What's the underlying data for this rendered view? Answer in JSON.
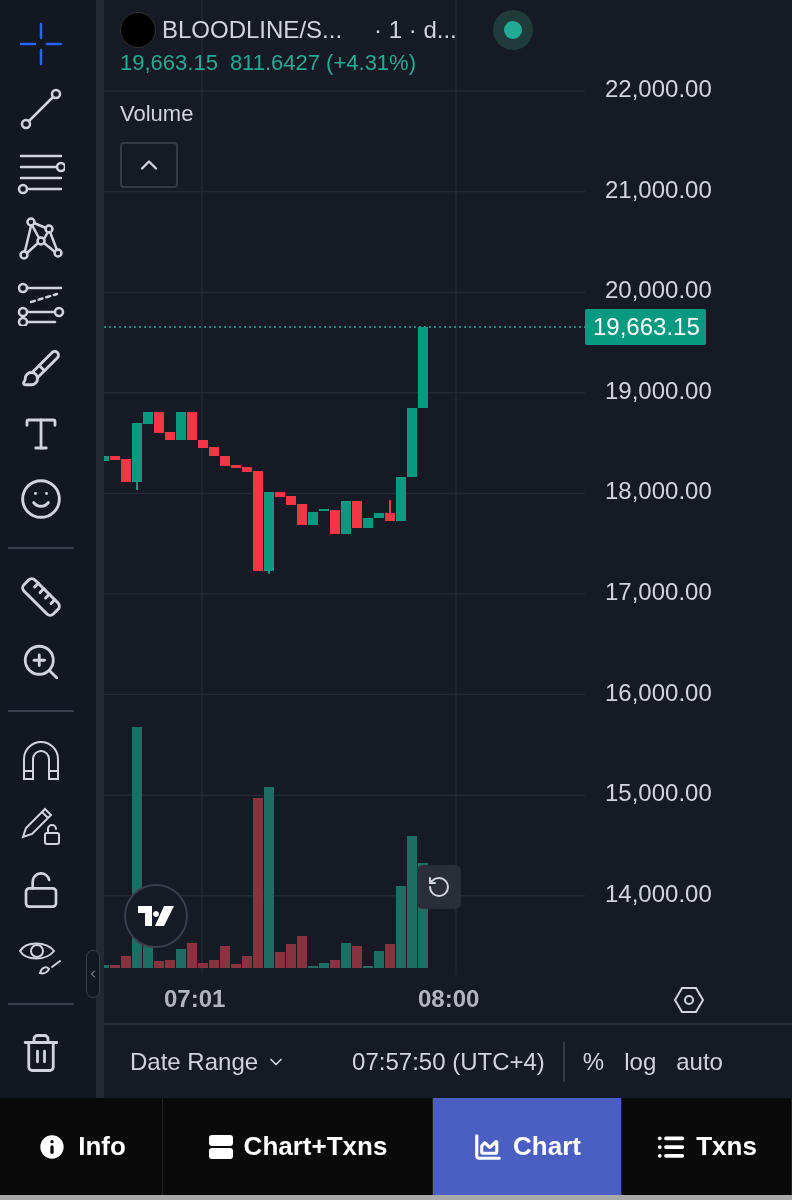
{
  "toolbar": {
    "groups": [
      [
        {
          "kind": "crosshair",
          "selected": true
        },
        {
          "kind": "trend-line",
          "selected": false
        },
        {
          "kind": "horizontal-lines",
          "selected": false
        },
        {
          "kind": "pattern",
          "selected": false
        },
        {
          "kind": "fib",
          "selected": false
        },
        {
          "kind": "brush",
          "selected": false
        },
        {
          "kind": "text",
          "selected": false
        },
        {
          "kind": "emoji",
          "selected": false
        }
      ],
      [
        {
          "kind": "ruler",
          "selected": false
        },
        {
          "kind": "zoom",
          "selected": false
        }
      ],
      [
        {
          "kind": "magnet",
          "selected": false
        },
        {
          "kind": "drawing-lock",
          "selected": false
        },
        {
          "kind": "lock",
          "selected": false
        },
        {
          "kind": "visibility",
          "selected": false
        }
      ],
      [
        {
          "kind": "trash",
          "selected": false
        }
      ]
    ]
  },
  "header": {
    "symbol": "BLOODLINE/S...",
    "interval": "· 1 · d...",
    "price": "19,663.15",
    "change": "811.6427 (+4.31%)"
  },
  "volume_pane": {
    "label": "Volume"
  },
  "price_axis": {
    "ticks": [
      "22,000.00",
      "21,000.00",
      "20,000.00",
      "19,000.00",
      "18,000.00",
      "17,000.00",
      "16,000.00",
      "15,000.00",
      "14,000.00"
    ],
    "current": "19,663.15"
  },
  "time_axis": {
    "ticks": [
      "07:01",
      "08:00"
    ]
  },
  "bottom_bar": {
    "date_range": "Date Range",
    "time": "07:57:50 (UTC+4)",
    "options": [
      "%",
      "log",
      "auto"
    ]
  },
  "tabs": [
    {
      "kind": "info",
      "label": "Info",
      "selected": false
    },
    {
      "kind": "split",
      "label": "Chart+Txns",
      "selected": false
    },
    {
      "kind": "chart",
      "label": "Chart",
      "selected": true
    },
    {
      "kind": "list",
      "label": "Txns",
      "selected": false
    }
  ]
}
